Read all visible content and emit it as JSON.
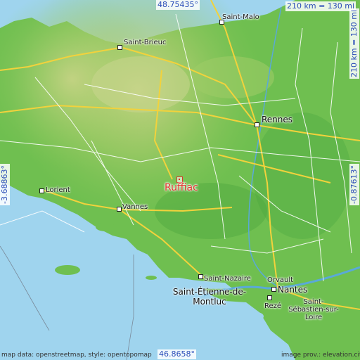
{
  "map": {
    "place": "Ruffiac",
    "coords": {
      "top": "48.75435°",
      "bottom": "46.8658°",
      "left": "-3.68863°",
      "right": "-0.87613°"
    },
    "scale": {
      "horizontal": "210 km = 130 mi",
      "vertical": "210 km = 130 mi"
    },
    "cities": [
      {
        "name": "Saint-Malo"
      },
      {
        "name": "Saint-Brieuc"
      },
      {
        "name": "Rennes"
      },
      {
        "name": "Lorient"
      },
      {
        "name": "Vannes"
      },
      {
        "name": "Saint-Nazaire"
      },
      {
        "name": "Saint-Étienne-de-Montluc"
      },
      {
        "name": "Orvault"
      },
      {
        "name": "Nantes"
      },
      {
        "name": "Rezé"
      },
      {
        "name": "Saint-Sébastien-sur-Loire"
      }
    ],
    "credits": {
      "left": "map data: openstreetmap, style: opentopomap",
      "right": "image prov.: elevation.city"
    },
    "colors": {
      "sea": "#9fd4ee",
      "land_low": "#5fb84a",
      "land_mid": "#8ec95a",
      "land_high": "#c5d58a",
      "road_major": "#f2d23c",
      "road_minor": "#ffffff",
      "place_marker": "#e0332b",
      "coord_text": "#2b4db8"
    }
  }
}
